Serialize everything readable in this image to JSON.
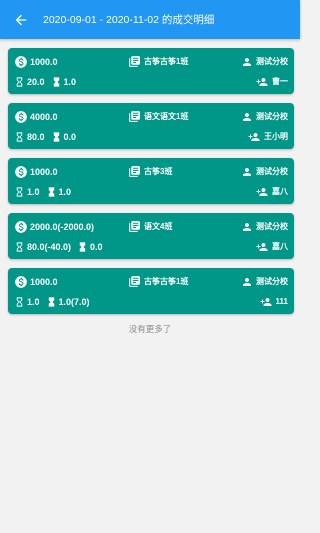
{
  "header": {
    "title": "2020-09-01 - 2020-11-02 的成交明细"
  },
  "colors": {
    "appbar": "#2196f3",
    "card": "#009688",
    "page_bg": "#f2f2f2",
    "footer_text": "#8a8a8a"
  },
  "icons": {
    "back": "arrow-back-icon",
    "money": "dollar-circle-icon",
    "class": "library-books-icon",
    "school": "person-icon",
    "students": "add-person-icon",
    "hourglass_empty": "hourglass-empty-icon",
    "hourglass_full": "hourglass-full-icon"
  },
  "records": [
    {
      "amount": "1000.0",
      "class_name": "古筝古筝1班",
      "school": "测试分校",
      "hours": "20.0",
      "count": "1.0",
      "student": "曹一"
    },
    {
      "amount": "4000.0",
      "class_name": "语文语文1班",
      "school": "测试分校",
      "hours": "80.0",
      "count": "0.0",
      "student": "王小明"
    },
    {
      "amount": "1000.0",
      "class_name": "古筝3班",
      "school": "测试分校",
      "hours": "1.0",
      "count": "1.0",
      "student": "嘉八"
    },
    {
      "amount": "2000.0(-2000.0)",
      "class_name": "语文4班",
      "school": "测试分校",
      "hours": "80.0(-40.0)",
      "count": "0.0",
      "student": "嘉八"
    },
    {
      "amount": "1000.0",
      "class_name": "古筝古筝1班",
      "school": "测试分校",
      "hours": "1.0",
      "count": "1.0(7.0)",
      "student": "111"
    }
  ],
  "footer": {
    "text": "没有更多了"
  }
}
